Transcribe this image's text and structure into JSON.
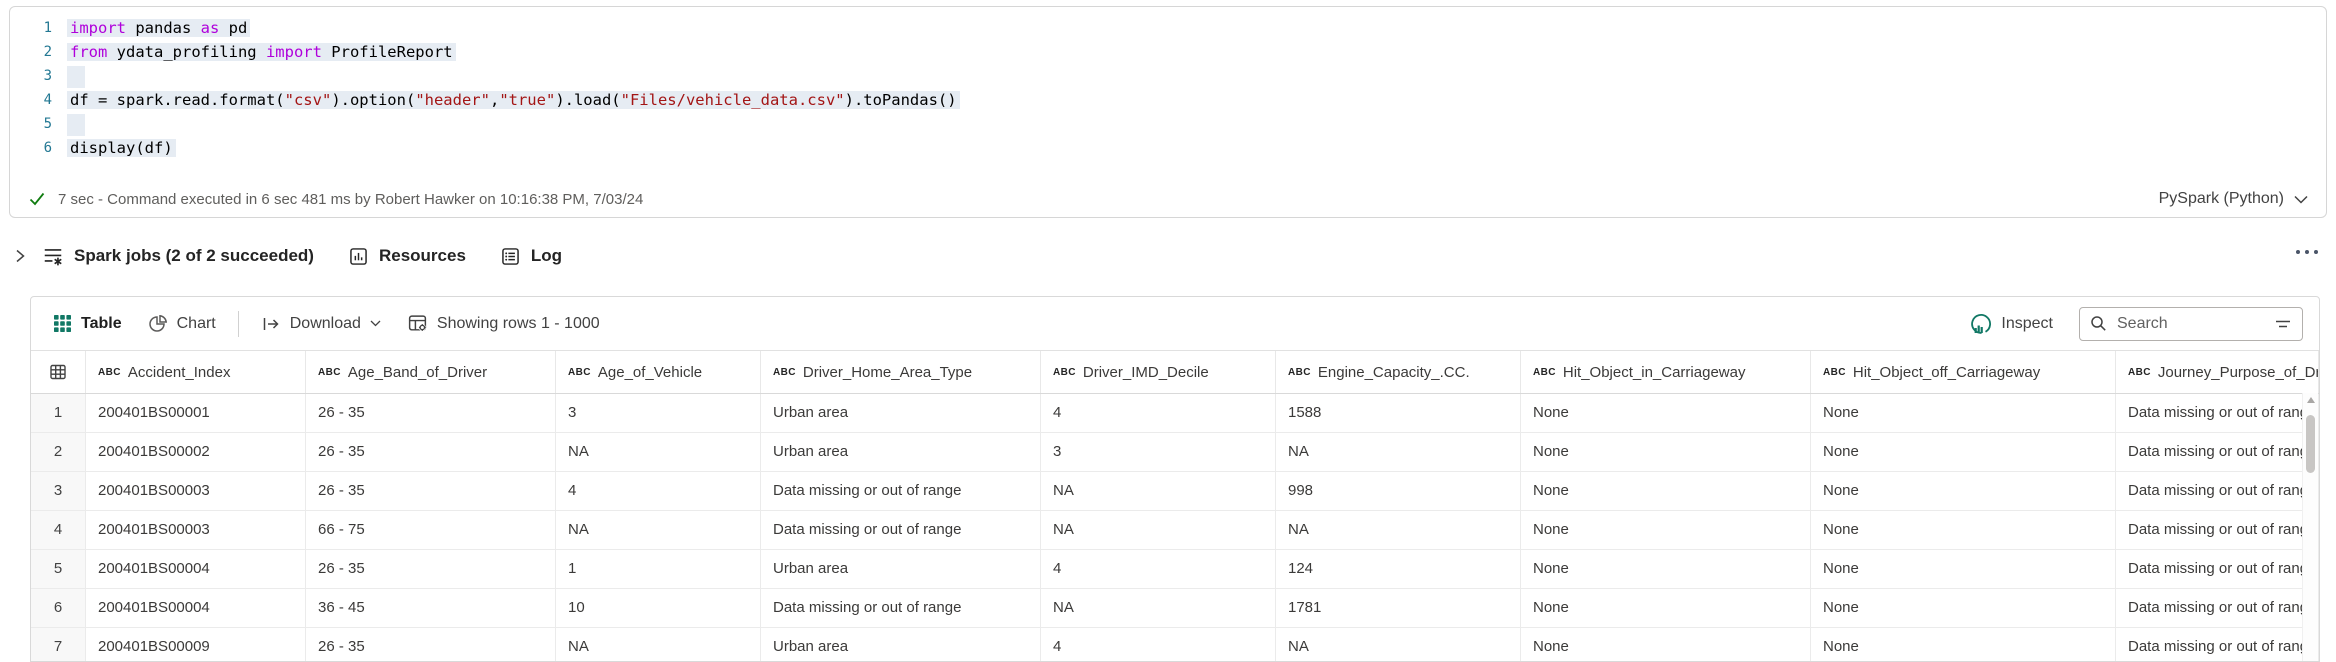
{
  "code_cell": {
    "language_label": "PySpark (Python)",
    "status_text": "7 sec - Command executed in 6 sec 481 ms by Robert Hawker on 10:16:38 PM, 7/03/24",
    "lines": [
      {
        "n": "1",
        "highlight": true,
        "segments": [
          {
            "t": "import",
            "c": "kw"
          },
          {
            "t": " pandas ",
            "c": ""
          },
          {
            "t": "as",
            "c": "kw"
          },
          {
            "t": " pd",
            "c": ""
          }
        ]
      },
      {
        "n": "2",
        "highlight": true,
        "segments": [
          {
            "t": "from",
            "c": "kw"
          },
          {
            "t": " ydata_profiling ",
            "c": ""
          },
          {
            "t": "import",
            "c": "kw"
          },
          {
            "t": " ProfileReport",
            "c": ""
          }
        ]
      },
      {
        "n": "3",
        "highlight": true,
        "segments": []
      },
      {
        "n": "4",
        "highlight": true,
        "segments": [
          {
            "t": "df = spark.read.format(",
            "c": ""
          },
          {
            "t": "\"csv\"",
            "c": "str"
          },
          {
            "t": ").option(",
            "c": ""
          },
          {
            "t": "\"header\"",
            "c": "str"
          },
          {
            "t": ",",
            "c": ""
          },
          {
            "t": "\"true\"",
            "c": "str"
          },
          {
            "t": ").load(",
            "c": ""
          },
          {
            "t": "\"Files/vehicle_data.csv\"",
            "c": "str"
          },
          {
            "t": ").toPandas()",
            "c": ""
          }
        ]
      },
      {
        "n": "5",
        "highlight": true,
        "segments": []
      },
      {
        "n": "6",
        "highlight": true,
        "segments": [
          {
            "t": "display(df)",
            "c": ""
          }
        ]
      }
    ]
  },
  "jobs_bar": {
    "spark_jobs": "Spark jobs (2 of 2 succeeded)",
    "resources": "Resources",
    "log": "Log"
  },
  "output_toolbar": {
    "table_tab": "Table",
    "chart_tab": "Chart",
    "download": "Download",
    "showing_rows": "Showing rows 1 - 1000",
    "inspect": "Inspect",
    "search_placeholder": "Search"
  },
  "table": {
    "columns": [
      {
        "type": "ABC",
        "name": "Accident_Index"
      },
      {
        "type": "ABC",
        "name": "Age_Band_of_Driver"
      },
      {
        "type": "ABC",
        "name": "Age_of_Vehicle"
      },
      {
        "type": "ABC",
        "name": "Driver_Home_Area_Type"
      },
      {
        "type": "ABC",
        "name": "Driver_IMD_Decile"
      },
      {
        "type": "ABC",
        "name": "Engine_Capacity_.CC."
      },
      {
        "type": "ABC",
        "name": "Hit_Object_in_Carriageway"
      },
      {
        "type": "ABC",
        "name": "Hit_Object_off_Carriageway"
      },
      {
        "type": "ABC",
        "name": "Journey_Purpose_of_Driver"
      }
    ],
    "rows": [
      {
        "n": "1",
        "cells": [
          "200401BS00001",
          "26 - 35",
          "3",
          "Urban area",
          "4",
          "1588",
          "None",
          "None",
          "Data missing or out of range"
        ]
      },
      {
        "n": "2",
        "cells": [
          "200401BS00002",
          "26 - 35",
          "NA",
          "Urban area",
          "3",
          "NA",
          "None",
          "None",
          "Data missing or out of range"
        ]
      },
      {
        "n": "3",
        "cells": [
          "200401BS00003",
          "26 - 35",
          "4",
          "Data missing or out of range",
          "NA",
          "998",
          "None",
          "None",
          "Data missing or out of range"
        ]
      },
      {
        "n": "4",
        "cells": [
          "200401BS00003",
          "66 - 75",
          "NA",
          "Data missing or out of range",
          "NA",
          "NA",
          "None",
          "None",
          "Data missing or out of range"
        ]
      },
      {
        "n": "5",
        "cells": [
          "200401BS00004",
          "26 - 35",
          "1",
          "Urban area",
          "4",
          "124",
          "None",
          "None",
          "Data missing or out of range"
        ]
      },
      {
        "n": "6",
        "cells": [
          "200401BS00004",
          "36 - 45",
          "10",
          "Data missing or out of range",
          "NA",
          "1781",
          "None",
          "None",
          "Data missing or out of range"
        ]
      },
      {
        "n": "7",
        "cells": [
          "200401BS00009",
          "26 - 35",
          "NA",
          "Urban area",
          "4",
          "NA",
          "None",
          "None",
          "Data missing or out of range"
        ]
      }
    ]
  },
  "icons": {
    "run_status": "checkmark",
    "language_dropdown": "chevron-down",
    "jobs_expander": "chevron-right",
    "spark_jobs": "list-star-icon",
    "resources": "bar-chart-square-icon",
    "log": "list-square-icon",
    "table_tab": "grid-icon",
    "chart_tab": "pie-chart-icon",
    "download": "export-arrow-icon",
    "showing_rows": "table-gear-icon",
    "inspect": "donut-bars-icon",
    "search": "magnifier-icon",
    "filter": "filter-lines-icon",
    "more": "ellipsis-icon",
    "header_corner": "table-grid-icon",
    "scroll_up": "triangle-up-icon"
  },
  "colors": {
    "accent_green": "#117865",
    "keyword": "#af00db",
    "string": "#a31515",
    "line_number": "#237893",
    "success_check": "#107c10",
    "selection_highlight": "#e6ecf3"
  }
}
